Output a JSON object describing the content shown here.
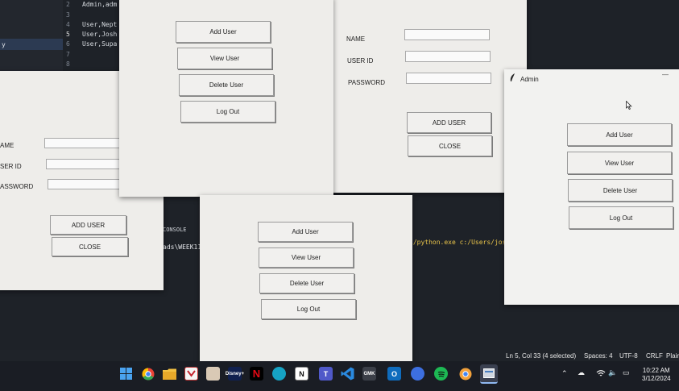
{
  "editor": {
    "gutter": [
      "2",
      "3",
      "4",
      "5",
      "6",
      "7",
      "8"
    ],
    "code_lines": [
      "Admin,adm",
      "",
      "User,Nept",
      "User,Josh",
      "User,Supa",
      "",
      ""
    ],
    "explorer_selected": "y",
    "terminal": {
      "tab_label": "CONSOLE",
      "path_fragment": "ads\\WEEK11>",
      "command_fragment": "2/python.exe c:/Users/jos"
    },
    "status": {
      "position": "Ln 5, Col 33 (4 selected)",
      "spaces": "Spaces: 4",
      "encoding": "UTF-8",
      "eol": "CRLF",
      "language": "Plair"
    }
  },
  "windows": {
    "add_user_left": {
      "labels": [
        "AME",
        "SER ID",
        "ASSWORD"
      ],
      "add_button": "ADD USER",
      "close_button": "CLOSE"
    },
    "menu_top": {
      "buttons": [
        "Add User",
        "View User",
        "Delete User",
        "Log Out"
      ]
    },
    "add_user_top": {
      "labels": [
        "NAME",
        "USER ID",
        "PASSWORD"
      ],
      "add_button": "ADD USER",
      "close_button": "CLOSE"
    },
    "menu_bottom": {
      "buttons": [
        "Add User",
        "View User",
        "Delete User",
        "Log Out"
      ]
    },
    "admin": {
      "title": "Admin",
      "minimize": "—",
      "buttons": [
        "Add User",
        "View User",
        "Delete User",
        "Log Out"
      ]
    }
  },
  "taskbar": {
    "icons": [
      "windows-start-icon",
      "chrome-icon",
      "file-explorer-icon",
      "app-red-icon",
      "photos-icon",
      "disney-plus-icon",
      "netflix-icon",
      "canva-icon",
      "notion-icon",
      "teams-icon",
      "vscode-icon",
      "gmk-icon",
      "outlook-icon",
      "app-blue-icon",
      "spotify-icon",
      "chrome-dev-icon",
      "python-app-icon"
    ],
    "disney_label": "Disney+",
    "notion_label": "N",
    "gmk_label": "GMK",
    "time": "10:22 AM",
    "date": "3/12/2024",
    "colors": {
      "accent": "#2f7de0",
      "netflix": "#e50914",
      "spotify": "#1db954"
    }
  }
}
